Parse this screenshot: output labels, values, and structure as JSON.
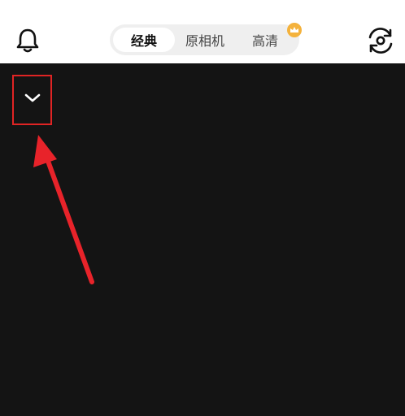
{
  "header": {
    "bell_icon": "bell-icon",
    "flip_camera_icon": "flip-camera-icon",
    "mode_tabs": [
      {
        "label": "经典",
        "active": true
      },
      {
        "label": "原相机",
        "active": false
      },
      {
        "label": "高清",
        "active": false,
        "badge_icon": "crown-icon"
      }
    ],
    "badge_color": "#f4b23c"
  },
  "viewfinder": {
    "background": "#141414",
    "collapse_icon": "chevron-down-icon"
  },
  "annotation": {
    "highlight_color": "#e02424",
    "arrow_color": "#e8232a"
  }
}
